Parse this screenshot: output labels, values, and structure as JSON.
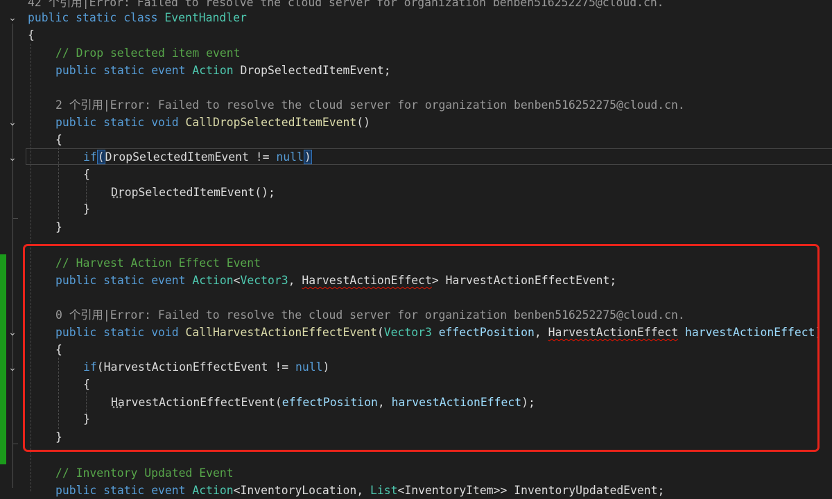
{
  "codelens": {
    "top": "42 个引用|Error: Failed to resolve the cloud server for organization benben516252275@cloud.cn.",
    "call_drop": "2 个引用|Error: Failed to resolve the cloud server for organization benben516252275@cloud.cn.",
    "call_harvest": "0 个引用|Error: Failed to resolve the cloud server for organization benben516252275@cloud.cn."
  },
  "code": {
    "kw_public": "public",
    "kw_static": "static",
    "kw_class": "class",
    "kw_event": "event",
    "kw_void": "void",
    "kw_if": "if",
    "kw_null": "null",
    "class_name": "EventHandler",
    "brace_open": "{",
    "brace_close": "}",
    "type_action": "Action",
    "type_vector3": "Vector3",
    "type_harvest_effect": "HarvestActionEffect",
    "comment_drop": "// Drop selected item event",
    "drop_event": "DropSelectedItemEvent",
    "call_drop_method": "CallDropSelectedItemEvent",
    "comment_harvest": "// Harvest Action Effect Event",
    "harvest_event": "HarvestActionEffectEvent",
    "call_harvest_method": "CallHarvestActionEffectEvent",
    "param_position": "effectPosition",
    "param_effect": "harvestActionEffect",
    "comment_inventory": "// Inventory Updated Event",
    "inventory_location": "InventoryLocation",
    "type_list": "List",
    "inventory_item": "InventoryItem",
    "inventory_event": "InventoryUpdatedEvent",
    "p_open": "(",
    "p_close": ")",
    "p_empty": "()",
    "call_end": "();",
    "semi": ";",
    "not_equal": " != ",
    "comma": ", ",
    "space": " ",
    "lt": "<",
    "gt": ">",
    "gtgt": ">>",
    "close_semi": ");"
  },
  "colors": {
    "keyword": "#569cd6",
    "type": "#4ec9b0",
    "comment": "#57a64a",
    "parameter": "#9cdcfe",
    "method": "#dcdcaa",
    "change_bar": "#1b9a1b",
    "annotation_box": "#e8241a"
  }
}
